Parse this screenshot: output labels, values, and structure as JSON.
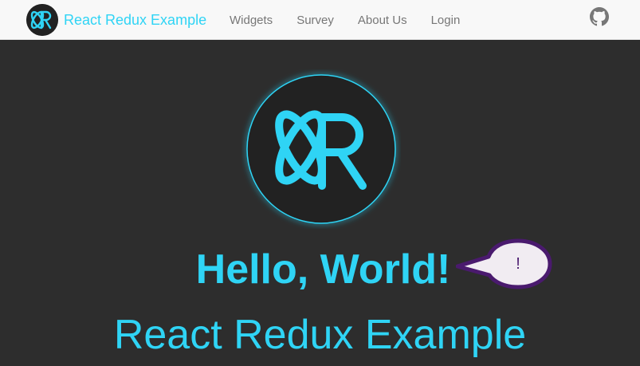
{
  "navbar": {
    "brand_title": "React Redux Example",
    "links": [
      {
        "label": "Widgets"
      },
      {
        "label": "Survey"
      },
      {
        "label": "About Us"
      },
      {
        "label": "Login"
      }
    ],
    "github_icon": "github-icon"
  },
  "hero": {
    "logo_icon": "react-redux-logo",
    "heading": "Hello, World!",
    "bubble_text": "!",
    "subtitle": "React Redux Example"
  },
  "colors": {
    "accent": "#2fd4f5",
    "navbar_bg": "#f8f8f8",
    "hero_bg": "#2d2d2d",
    "bubble_border": "#4a1a6e",
    "bubble_fill": "#f1ecf2"
  }
}
